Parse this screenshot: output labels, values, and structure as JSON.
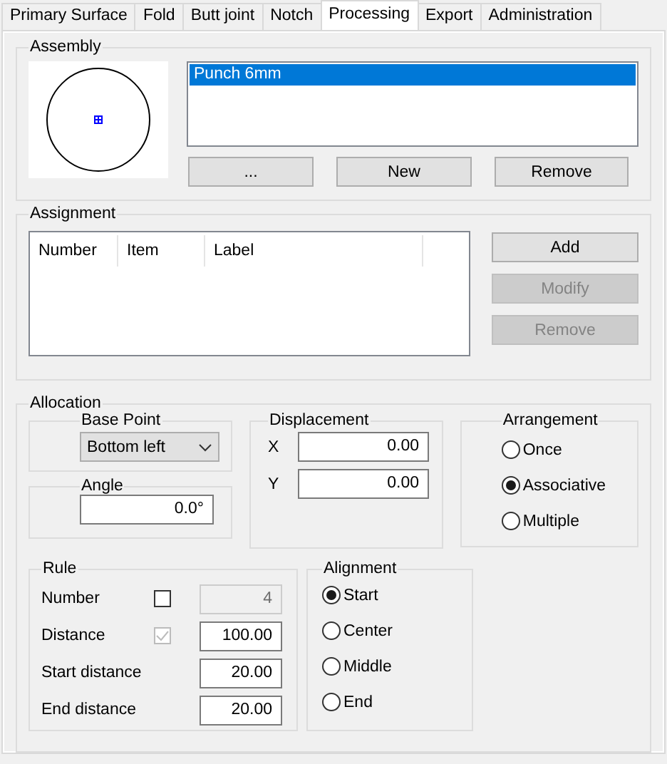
{
  "tabs": [
    {
      "label": "Primary Surface",
      "selected": false
    },
    {
      "label": "Fold",
      "selected": false
    },
    {
      "label": "Butt joint",
      "selected": false
    },
    {
      "label": "Notch",
      "selected": false
    },
    {
      "label": "Processing",
      "selected": true
    },
    {
      "label": "Export",
      "selected": false
    },
    {
      "label": "Administration",
      "selected": false
    }
  ],
  "assembly": {
    "title": "Assembly",
    "items": [
      {
        "label": "Punch 6mm",
        "selected": true
      }
    ],
    "buttons": [
      {
        "label": "...",
        "disabled": false
      },
      {
        "label": "New",
        "disabled": false
      },
      {
        "label": "Remove",
        "disabled": false
      }
    ]
  },
  "assignment": {
    "title": "Assignment",
    "columns": [
      "Number",
      "Item",
      "Label"
    ],
    "buttons": [
      {
        "label": "Add",
        "disabled": false
      },
      {
        "label": "Modify",
        "disabled": true
      },
      {
        "label": "Remove",
        "disabled": true
      }
    ]
  },
  "allocation": {
    "title": "Allocation",
    "base_point": {
      "title": "Base Point",
      "value": "Bottom left"
    },
    "angle": {
      "title": "Angle",
      "value": "0.0°"
    },
    "displacement": {
      "title": "Displacement",
      "fields": [
        {
          "label": "X",
          "value": "0.00"
        },
        {
          "label": "Y",
          "value": "0.00"
        }
      ]
    },
    "arrangement": {
      "title": "Arrangement",
      "options": [
        {
          "label": "Once",
          "selected": false
        },
        {
          "label": "Associative",
          "selected": true
        },
        {
          "label": "Multiple",
          "selected": false
        }
      ]
    },
    "rule": {
      "title": "Rule",
      "rows": [
        {
          "kind": "check",
          "label": "Number",
          "checked": false,
          "checkbox_disabled": false,
          "value": "4",
          "field_disabled": true
        },
        {
          "kind": "check",
          "label": "Distance",
          "checked": true,
          "checkbox_disabled": true,
          "value": "100.00",
          "field_disabled": false
        },
        {
          "kind": "plain",
          "label": "Start distance",
          "value": "20.00",
          "field_disabled": false
        },
        {
          "kind": "plain",
          "label": "End distance",
          "value": "20.00",
          "field_disabled": false
        }
      ]
    },
    "alignment": {
      "title": "Alignment",
      "options": [
        {
          "label": "Start",
          "selected": true
        },
        {
          "label": "Center",
          "selected": false
        },
        {
          "label": "Middle",
          "selected": false
        },
        {
          "label": "End",
          "selected": false
        }
      ]
    }
  }
}
